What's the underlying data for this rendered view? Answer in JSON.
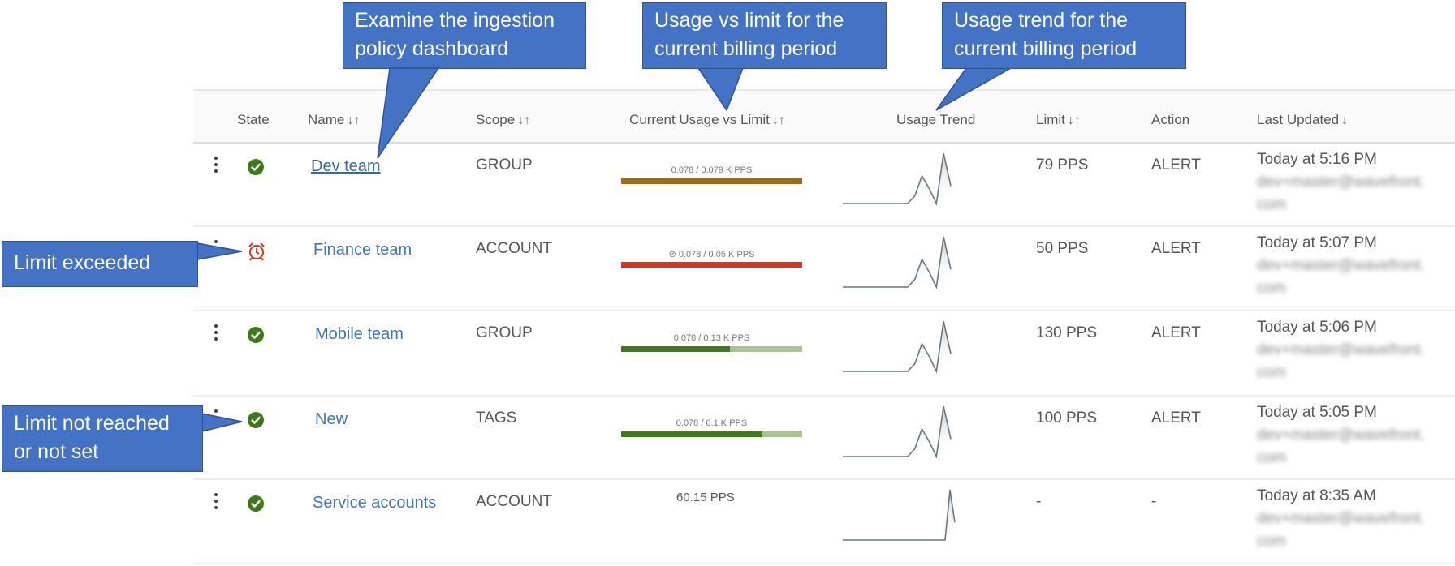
{
  "columns": {
    "state": "State",
    "name": "Name",
    "scope": "Scope",
    "usage": "Current Usage vs Limit",
    "trend": "Usage Trend",
    "limit": "Limit",
    "action": "Action",
    "updated": "Last Updated"
  },
  "sort_icons": {
    "both": "↓↑",
    "down": "↓"
  },
  "rows": [
    {
      "state": "ok",
      "name": "Dev team",
      "scope": "GROUP",
      "usage_label": "0.078 / 0.079 K PPS",
      "usage_fraction": 1.0,
      "usage_color": "#9c6a1a",
      "usage_track": "#c9a86a",
      "limit": "79 PPS",
      "action": "ALERT",
      "updated_time": "Today at 5:16 PM",
      "updated_by_line1": "dev+master@wavefront.",
      "updated_by_line2": "com",
      "trend": [
        0,
        0,
        0,
        0,
        0,
        0,
        0,
        0,
        0,
        0,
        0.15,
        0.55,
        0.3,
        0,
        1.0,
        0.35
      ]
    },
    {
      "state": "exceeded",
      "name": "Finance team",
      "scope": "ACCOUNT",
      "usage_label": "⊘ 0.078 / 0.05 K PPS",
      "usage_fraction": 1.0,
      "usage_color": "#d6361e",
      "usage_track": "#d6361e",
      "limit": "50 PPS",
      "action": "ALERT",
      "updated_time": "Today at 5:07 PM",
      "updated_by_line1": "dev+master@wavefront.",
      "updated_by_line2": "com",
      "trend": [
        0,
        0,
        0,
        0,
        0,
        0,
        0,
        0,
        0,
        0,
        0.15,
        0.55,
        0.3,
        0,
        1.0,
        0.35
      ]
    },
    {
      "state": "ok",
      "name": "Mobile team",
      "scope": "GROUP",
      "usage_label": "0.078 / 0.13 K PPS",
      "usage_fraction": 0.6,
      "usage_color": "#3f7a1a",
      "usage_track": "#a7c38e",
      "limit": "130 PPS",
      "action": "ALERT",
      "updated_time": "Today at 5:06 PM",
      "updated_by_line1": "dev+master@wavefront.",
      "updated_by_line2": "com",
      "trend": [
        0,
        0,
        0,
        0,
        0,
        0,
        0,
        0,
        0,
        0,
        0.15,
        0.55,
        0.3,
        0,
        1.0,
        0.35
      ]
    },
    {
      "state": "ok",
      "name": "New",
      "scope": "TAGS",
      "usage_label": "0.078 / 0.1 K PPS",
      "usage_fraction": 0.78,
      "usage_color": "#3f7a1a",
      "usage_track": "#a7c38e",
      "limit": "100 PPS",
      "action": "ALERT",
      "updated_time": "Today at 5:05 PM",
      "updated_by_line1": "dev+master@wavefront.",
      "updated_by_line2": "com",
      "trend": [
        0,
        0,
        0,
        0,
        0,
        0,
        0,
        0,
        0,
        0,
        0.15,
        0.55,
        0.3,
        0,
        1.0,
        0.35
      ]
    },
    {
      "state": "ok",
      "name": "Service accounts",
      "scope": "ACCOUNT",
      "usage_plain": "60.15 PPS",
      "limit": "-",
      "action": "-",
      "updated_time": "Today at 8:35 AM",
      "updated_by_line1": "dev+master@wavefront.",
      "updated_by_line2": "com",
      "trend": [
        0,
        0,
        0,
        0,
        0,
        0,
        0,
        0,
        0,
        0,
        0,
        0,
        0,
        0,
        1.0,
        0.35
      ]
    }
  ],
  "callouts": {
    "examine": "Examine the ingestion policy dashboard",
    "examine_l1": "Examine the ingestion",
    "examine_l2": "policy dashboard",
    "usage_l1": "Usage vs limit for the",
    "usage_l2": "current billing period",
    "trend_l1": "Usage trend for the",
    "trend_l2": "current billing period",
    "exceeded": "Limit exceeded",
    "notreached_l1": "Limit not reached",
    "notreached_l2": "or not set"
  },
  "colors": {
    "ok": "#3f7a1a",
    "exceeded": "#d6361e",
    "callout_bg": "#4472c4",
    "link": "#3f78b0"
  }
}
